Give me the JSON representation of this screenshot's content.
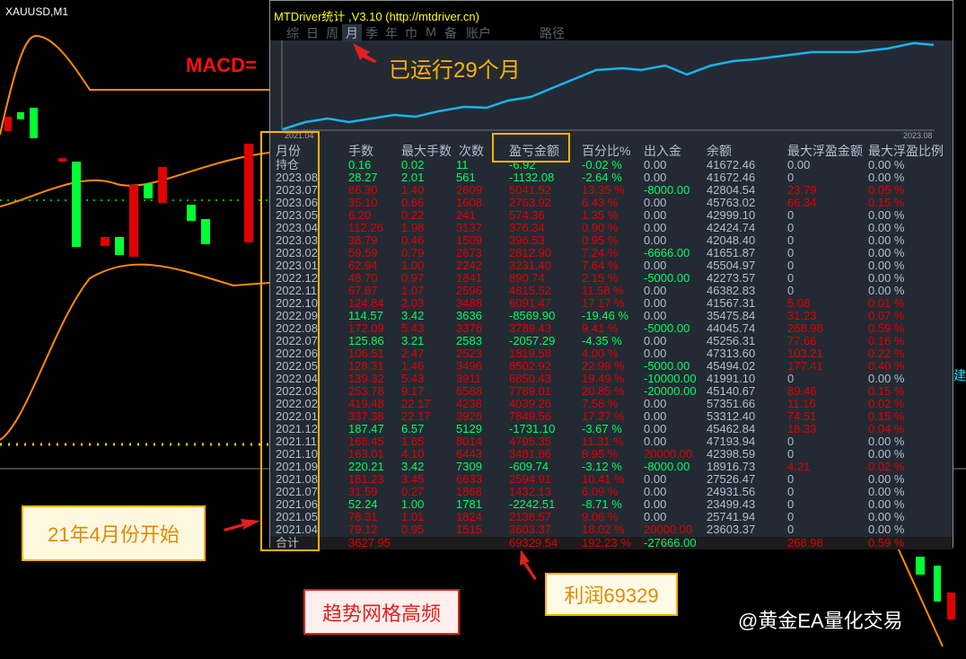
{
  "chart_symbol": "XAUUSD,M1",
  "macd_label": "MACD=",
  "side_label": "建",
  "panel": {
    "title": "MTDriver统计 ,V3.10 (http://mtdriver.cn)",
    "tabs": [
      "综",
      "日",
      "周",
      "月",
      "季",
      "年",
      "巾",
      "M",
      "备",
      "账户"
    ],
    "active_tab": "月",
    "path_label": "路径",
    "equity_start": "2021.04",
    "equity_end": "2023.08",
    "headers": [
      "月份",
      "手数",
      "最大手数",
      "次数",
      "盈亏金额",
      "百分比%",
      "出入金",
      "余额",
      "最大浮盈金额",
      "最大浮盈比例"
    ],
    "rows": [
      [
        "持仓",
        "0.16",
        "0.02",
        "11",
        "-6.92",
        "-0.02 %",
        "0.00",
        "41672.46",
        "0.00",
        "0.00 %"
      ],
      [
        "2023.08",
        "28.27",
        "2.01",
        "561",
        "-1132.08",
        "-2.64 %",
        "0.00",
        "41672.46",
        "0",
        "0.00 %"
      ],
      [
        "2023.07",
        "86.30",
        "1.40",
        "2609",
        "5041.52",
        "13.35 %",
        "-8000.00",
        "42804.54",
        "23.79",
        "0.05 %"
      ],
      [
        "2023.06",
        "35.10",
        "0.66",
        "1608",
        "2763.92",
        "6.43 %",
        "0.00",
        "45763.02",
        "66.34",
        "0.15 %"
      ],
      [
        "2023.05",
        "6.20",
        "0.22",
        "241",
        "574.36",
        "1.35 %",
        "0.00",
        "42999.10",
        "0",
        "0.00 %"
      ],
      [
        "2023.04",
        "112.26",
        "1.98",
        "3137",
        "376.34",
        "0.90 %",
        "0.00",
        "42424.74",
        "0",
        "0.00 %"
      ],
      [
        "2023.03",
        "38.79",
        "0.46",
        "1509",
        "396.53",
        "0.95 %",
        "0.00",
        "42048.40",
        "0",
        "0.00 %"
      ],
      [
        "2023.02",
        "59.59",
        "0.79",
        "2673",
        "2812.90",
        "7.24 %",
        "-6666.00",
        "41651.87",
        "0",
        "0.00 %"
      ],
      [
        "2023.01",
        "62.94",
        "1.00",
        "2242",
        "3231.40",
        "7.64 %",
        "0.00",
        "45504.97",
        "0",
        "0.00 %"
      ],
      [
        "2022.12",
        "48.70",
        "0.97",
        "1841",
        "890.74",
        "2.15 %",
        "-5000.00",
        "42273.57",
        "0",
        "0.00 %"
      ],
      [
        "2022.11",
        "67.87",
        "1.07",
        "2596",
        "4815.52",
        "11.58 %",
        "0.00",
        "46382.83",
        "0",
        "0.00 %"
      ],
      [
        "2022.10",
        "124.84",
        "2.03",
        "3488",
        "6091.47",
        "17.17 %",
        "0.00",
        "41567.31",
        "5.08",
        "0.01 %"
      ],
      [
        "2022.09",
        "114.57",
        "3.42",
        "3636",
        "-8569.90",
        "-19.46 %",
        "0.00",
        "35475.84",
        "31.23",
        "0.07 %"
      ],
      [
        "2022.08",
        "172.09",
        "5.43",
        "3376",
        "3789.43",
        "9.41 %",
        "-5000.00",
        "44045.74",
        "268.98",
        "0.59 %"
      ],
      [
        "2022.07",
        "125.86",
        "3.21",
        "2583",
        "-2057.29",
        "-4.35 %",
        "0.00",
        "45256.31",
        "77.66",
        "0.16 %"
      ],
      [
        "2022.06",
        "106.51",
        "2.47",
        "2523",
        "1819.58",
        "4.00 %",
        "0.00",
        "47313.60",
        "103.21",
        "0.22 %"
      ],
      [
        "2022.05",
        "128.31",
        "1.46",
        "3496",
        "8502.92",
        "22.99 %",
        "-5000.00",
        "45494.02",
        "177.41",
        "0.40 %"
      ],
      [
        "2022.04",
        "139.32",
        "5.43",
        "3911",
        "6850.43",
        "19.49 %",
        "-10000.00",
        "41991.10",
        "0",
        "0.00 %"
      ],
      [
        "2022.03",
        "253.78",
        "9.17",
        "6588",
        "7789.01",
        "20.85 %",
        "-20000.00",
        "45140.67",
        "89.46",
        "0.15 %"
      ],
      [
        "2022.02",
        "419.48",
        "22.17",
        "4238",
        "4039.26",
        "7.58 %",
        "0.00",
        "57351.66",
        "11.16",
        "0.02 %"
      ],
      [
        "2022.01",
        "337.38",
        "22.17",
        "3926",
        "7849.56",
        "17.27 %",
        "0.00",
        "53312.40",
        "74.51",
        "0.15 %"
      ],
      [
        "2021.12",
        "187.47",
        "6.57",
        "5129",
        "-1731.10",
        "-3.67 %",
        "0.00",
        "45462.84",
        "18.33",
        "0.04 %"
      ],
      [
        "2021.11",
        "166.45",
        "1.65",
        "8014",
        "4795.35",
        "11.31 %",
        "0.00",
        "47193.94",
        "0",
        "0.00 %"
      ],
      [
        "2021.10",
        "163.01",
        "4.10",
        "6443",
        "3481.86",
        "8.95 %",
        "20000.00",
        "42398.59",
        "0",
        "0.00 %"
      ],
      [
        "2021.09",
        "220.21",
        "3.42",
        "7309",
        "-609.74",
        "-3.12 %",
        "-8000.00",
        "18916.73",
        "4.21",
        "0.02 %"
      ],
      [
        "2021.08",
        "181.23",
        "3.45",
        "6633",
        "2594.91",
        "10.41 %",
        "0.00",
        "27526.47",
        "0",
        "0.00 %"
      ],
      [
        "2021.07",
        "31.59",
        "0.27",
        "1868",
        "1432.13",
        "6.09 %",
        "0.00",
        "24931.56",
        "0",
        "0.00 %"
      ],
      [
        "2021.06",
        "52.24",
        "1.00",
        "1781",
        "-2242.51",
        "-8.71 %",
        "0.00",
        "23499.43",
        "0",
        "0.00 %"
      ],
      [
        "2021.05",
        "78.31",
        "1.01",
        "1824",
        "2138.57",
        "9.06 %",
        "0.00",
        "25741.94",
        "0",
        "0.00 %"
      ],
      [
        "2021.04",
        "79.12",
        "0.95",
        "1515",
        "3603.37",
        "18.02 %",
        "20000.00",
        "23603.37",
        "0",
        "0.00 %"
      ]
    ],
    "total": [
      "合计",
      "3627.95",
      "",
      "",
      "69329.54",
      "192.23 %",
      "-27666.00",
      "",
      "268.98",
      "0.59 %"
    ]
  },
  "annotations": {
    "running": "已运行29个月",
    "start": "21年4月份开始",
    "profit": "利润69329",
    "strategy": "趋势网格高频",
    "watermark": "@黄金EA量化交易"
  },
  "colors": {
    "profit": "#e00000",
    "loss": "#00ff66",
    "neutral": "#b4bdcf",
    "highlight": "#ffb300"
  }
}
